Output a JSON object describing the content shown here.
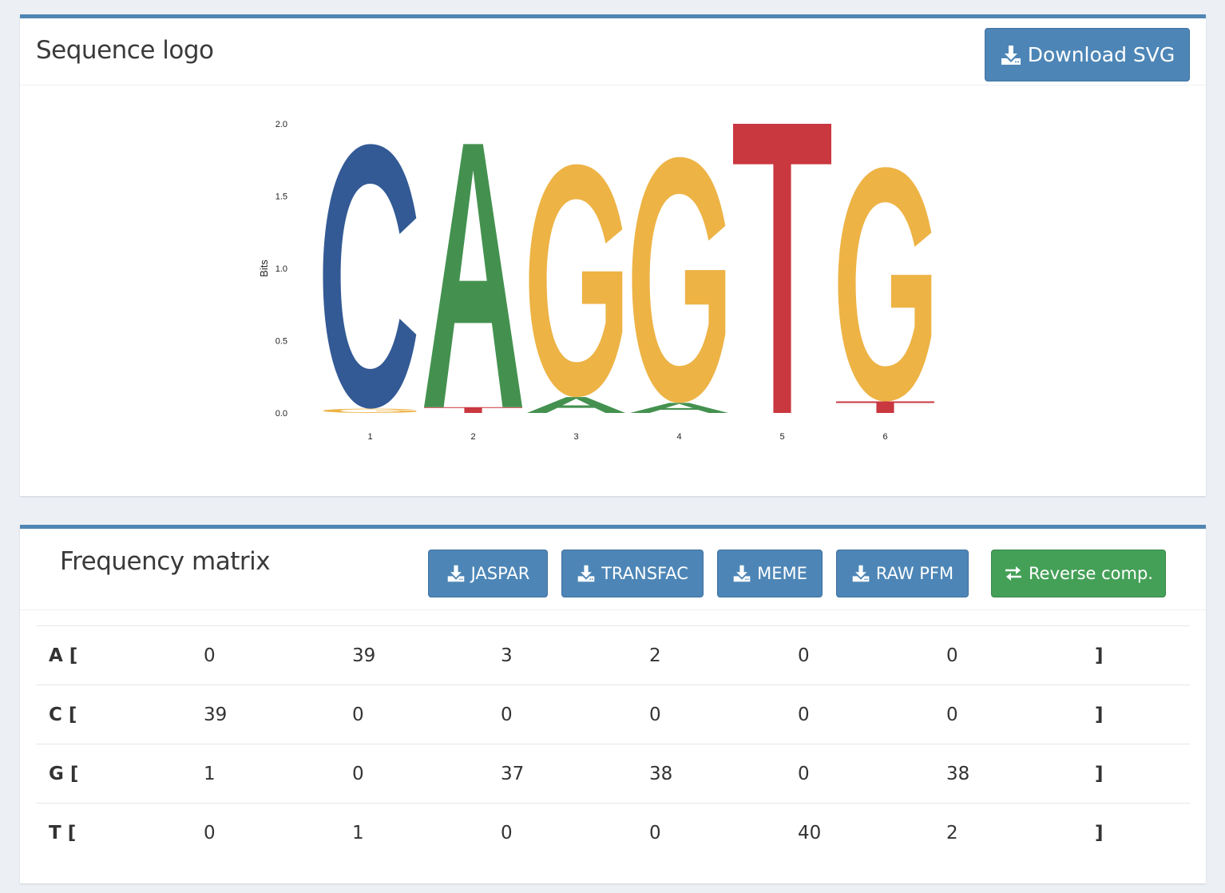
{
  "logo_panel": {
    "title": "Sequence logo",
    "download_label": "Download SVG"
  },
  "chart_data": {
    "type": "sequence-logo",
    "ylabel": "Bits",
    "ylim": [
      0,
      2.0
    ],
    "yticks": [
      "0.0",
      "0.5",
      "1.0",
      "1.5",
      "2.0"
    ],
    "positions": [
      "1",
      "2",
      "3",
      "4",
      "5",
      "6"
    ],
    "columns": [
      {
        "position": "1",
        "letters": [
          {
            "base": "G",
            "bits": 0.03
          },
          {
            "base": "C",
            "bits": 1.83
          }
        ]
      },
      {
        "position": "2",
        "letters": [
          {
            "base": "T",
            "bits": 0.04
          },
          {
            "base": "A",
            "bits": 1.82
          }
        ]
      },
      {
        "position": "3",
        "letters": [
          {
            "base": "A",
            "bits": 0.11
          },
          {
            "base": "G",
            "bits": 1.61
          }
        ]
      },
      {
        "position": "4",
        "letters": [
          {
            "base": "A",
            "bits": 0.07
          },
          {
            "base": "G",
            "bits": 1.7
          }
        ]
      },
      {
        "position": "5",
        "letters": [
          {
            "base": "T",
            "bits": 2.0
          }
        ]
      },
      {
        "position": "6",
        "letters": [
          {
            "base": "T",
            "bits": 0.08
          },
          {
            "base": "G",
            "bits": 1.62
          }
        ]
      }
    ],
    "colors": {
      "A": "#44914f",
      "C": "#335a95",
      "G": "#edb345",
      "T": "#c9373f"
    }
  },
  "matrix_panel": {
    "title": "Frequency matrix",
    "buttons": {
      "jaspar": "JASPAR",
      "transfac": "TRANSFAC",
      "meme": "MEME",
      "raw_pfm": "RAW PFM",
      "reverse": "Reverse comp."
    },
    "close_bracket": "]",
    "rows": [
      {
        "label": "A [",
        "values": [
          "0",
          "39",
          "3",
          "2",
          "0",
          "0"
        ]
      },
      {
        "label": "C [",
        "values": [
          "39",
          "0",
          "0",
          "0",
          "0",
          "0"
        ]
      },
      {
        "label": "G [",
        "values": [
          "1",
          "0",
          "37",
          "38",
          "0",
          "38"
        ]
      },
      {
        "label": "T [",
        "values": [
          "0",
          "1",
          "0",
          "0",
          "40",
          "2"
        ]
      }
    ]
  },
  "colors": {
    "primary": "#4d86b6",
    "success": "#44a057",
    "panel_border": "#4f86b4"
  }
}
